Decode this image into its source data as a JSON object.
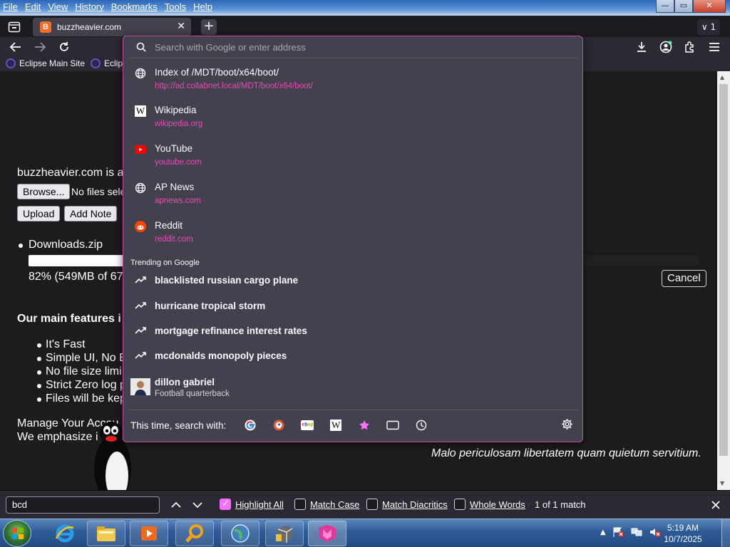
{
  "menubar": {
    "items": [
      "File",
      "Edit",
      "View",
      "History",
      "Bookmarks",
      "Tools",
      "Help"
    ],
    "window_controls": {
      "minimize": "—",
      "maximize": "▭",
      "close": "✕"
    }
  },
  "tabs": {
    "active_favicon": "B",
    "active_title": "buzzheavier.com",
    "new_tab": "+",
    "count": "∨ 1"
  },
  "bookmarks": [
    {
      "label": "Eclipse Main Site"
    },
    {
      "label": "Eclips"
    }
  ],
  "page": {
    "intro": "buzzheavier.com is a",
    "browse_label": "Browse...",
    "no_files": "No files selec",
    "upload_label": "Upload",
    "add_note_label": "Add Note",
    "download_name": "Downloads.zip",
    "progress_text": "82% (549MB of 67",
    "progress_fraction": 0.82,
    "cancel_label": "Cancel",
    "features_heading": "Our main features i",
    "features": [
      "It's Fast",
      "Simple UI, No E",
      "No file size limi",
      "Strict Zero log p",
      "Files will be kep"
    ],
    "manage_line1": "Manage Your Accou",
    "manage_line2": "We emphasize i",
    "latin": "Malo periculosam libertatem quam quietum servitium."
  },
  "urlbar": {
    "placeholder": "Search with Google or enter address",
    "results": [
      {
        "title": "Index of /MDT/boot/x64/boot/",
        "url": "http://ad.collabnet.local/MDT/boot/x64/boot/",
        "icon": "globe-icon"
      },
      {
        "title": "Wikipedia",
        "url": "wikipedia.org",
        "icon": "wikipedia-icon"
      },
      {
        "title": "YouTube",
        "url": "youtube.com",
        "icon": "youtube-icon"
      },
      {
        "title": "AP News",
        "url": "apnews.com",
        "icon": "globe-icon"
      },
      {
        "title": "Reddit",
        "url": "reddit.com",
        "icon": "reddit-icon"
      }
    ],
    "trending_heading": "Trending on Google",
    "trending": [
      "blacklisted russian cargo plane",
      "hurricane tropical storm",
      "mortgage refinance interest rates",
      "mcdonalds monopoly pieces"
    ],
    "person": {
      "name": "dillon gabriel",
      "subtitle": "Football quarterback"
    },
    "search_with_label": "This time, search with:",
    "engines": [
      "google-icon",
      "duckduckgo-icon",
      "ebay-icon",
      "wikipedia-icon",
      "bookmarks-star-icon",
      "tabs-icon",
      "history-icon"
    ]
  },
  "findbar": {
    "query": "bcd",
    "highlight_all": "Highlight All",
    "highlight_all_checked": true,
    "match_case": "Match Case",
    "match_diacritics": "Match Diacritics",
    "whole_words": "Whole Words",
    "status": "1 of 1 match"
  },
  "taskbar": {
    "time": "5:19 AM",
    "date": "10/7/2025"
  },
  "colors": {
    "accent_pink": "#e44cb6",
    "panel_bg": "#42414d",
    "panel_border": "#bb4ca0",
    "check_on": "#f770ff"
  }
}
